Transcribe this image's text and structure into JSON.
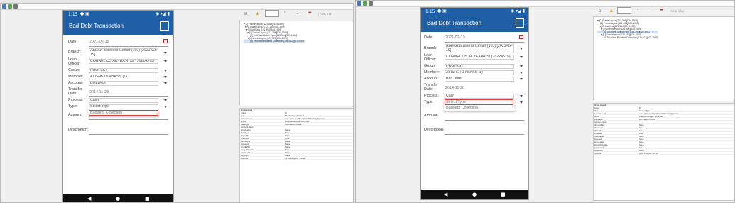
{
  "device": {
    "status_time": "1:15",
    "app_title": "Bad Debt Transaction",
    "save_icon": "save-icon",
    "nav_back": "◀",
    "nav_home": "●",
    "nav_recent": "■"
  },
  "form": {
    "date_label": "Date:",
    "date_value": "2021-02-19",
    "branch_label": "Branch:",
    "branch_value": "ABEKA Business Center (103) [2021-02-19]",
    "loan_officer_label": "Loan Officer:",
    "loan_officer_value": "CORNELIUS AKYEA AYISI (10224575)",
    "group_label": "Group:",
    "group_value": "PROTEST",
    "member_label": "Member:",
    "member_value": "AYISHETU ABASS (1)",
    "account_label": "Account:",
    "account_value": "Bad Debt",
    "transfer_date_label": "Transfer Date:",
    "transfer_date_value": "2014-11-28",
    "process_label": "Process:",
    "process_value": "Cash",
    "type_label": "Type:",
    "type_value": "Select Type",
    "type_option": "Baddebt Collection",
    "amount_label": "Amount:",
    "description_label": "Description:"
  },
  "inspector": {
    "toolbar_value": "(1096, 538)",
    "tree_left": [
      "▾ [0] FrameLayout [121,394][534,1909]",
      "  ▾ [0] FrameLayout [121,394][534,1909]",
      "    ▾ [0] ListView [121,394][534,1909]",
      "      ▾ [0] LinearLayout [121,394][534,1909]",
      "          [0] TextView Select Type [136,394][527,1911]",
      "      ▾ [1] LinearLayout [121,911][534,1909]",
      "          [0] TextView Baddebt Collection [136,911][527,1909]"
    ],
    "tree_right": [
      "▾ [0] FrameLayout [121,394][534,1909]",
      "  ▾ [0] FrameLayout [121,394][534,1909]",
      "    ▾ [0] ListView [121,394][534,1909]",
      "      ▾ [0] LinearLayout [121,394][534,1909]",
      "          [0] TextView Select Type [136,394][527,1911]",
      "      ▾ [1] LinearLayout [121,911][534,1909]",
      "          [0] TextView Baddebt Collection [136,911][527,1909]"
    ],
    "details_header": "Node Detail",
    "details_left": [
      [
        "index",
        "0"
      ],
      [
        "text",
        "Baddebt Collection"
      ],
      [
        "resource-id",
        "com.ants.mobile:id/text1/Select_Spinner"
      ],
      [
        "class",
        "android.widget.TextView"
      ],
      [
        "package",
        "com.ants.mobile"
      ],
      [
        "content-desc",
        ""
      ],
      [
        "checkable",
        "false"
      ],
      [
        "checked",
        "false"
      ],
      [
        "clickable",
        "false"
      ],
      [
        "enabled",
        "true"
      ],
      [
        "focusable",
        "false"
      ],
      [
        "focused",
        "false"
      ],
      [
        "scrollable",
        "false"
      ],
      [
        "long-clickable",
        "false"
      ],
      [
        "password",
        "false"
      ],
      [
        "selected",
        "false"
      ],
      [
        "bounds",
        "[136,911][527,1909]"
      ]
    ],
    "details_right": [
      [
        "index",
        "0"
      ],
      [
        "text",
        "Select Type"
      ],
      [
        "resource-id",
        "com.ants.mobile:id/text1/Select_Spinner"
      ],
      [
        "class",
        "android.widget.TextView"
      ],
      [
        "package",
        "com.ants.mobile"
      ],
      [
        "content-desc",
        ""
      ],
      [
        "checkable",
        "false"
      ],
      [
        "checked",
        "false"
      ],
      [
        "clickable",
        "false"
      ],
      [
        "enabled",
        "true"
      ],
      [
        "focusable",
        "false"
      ],
      [
        "focused",
        "false"
      ],
      [
        "scrollable",
        "false"
      ],
      [
        "long-clickable",
        "false"
      ],
      [
        "password",
        "false"
      ],
      [
        "selected",
        "false"
      ],
      [
        "bounds",
        "[136,394][527,1911]"
      ]
    ]
  }
}
